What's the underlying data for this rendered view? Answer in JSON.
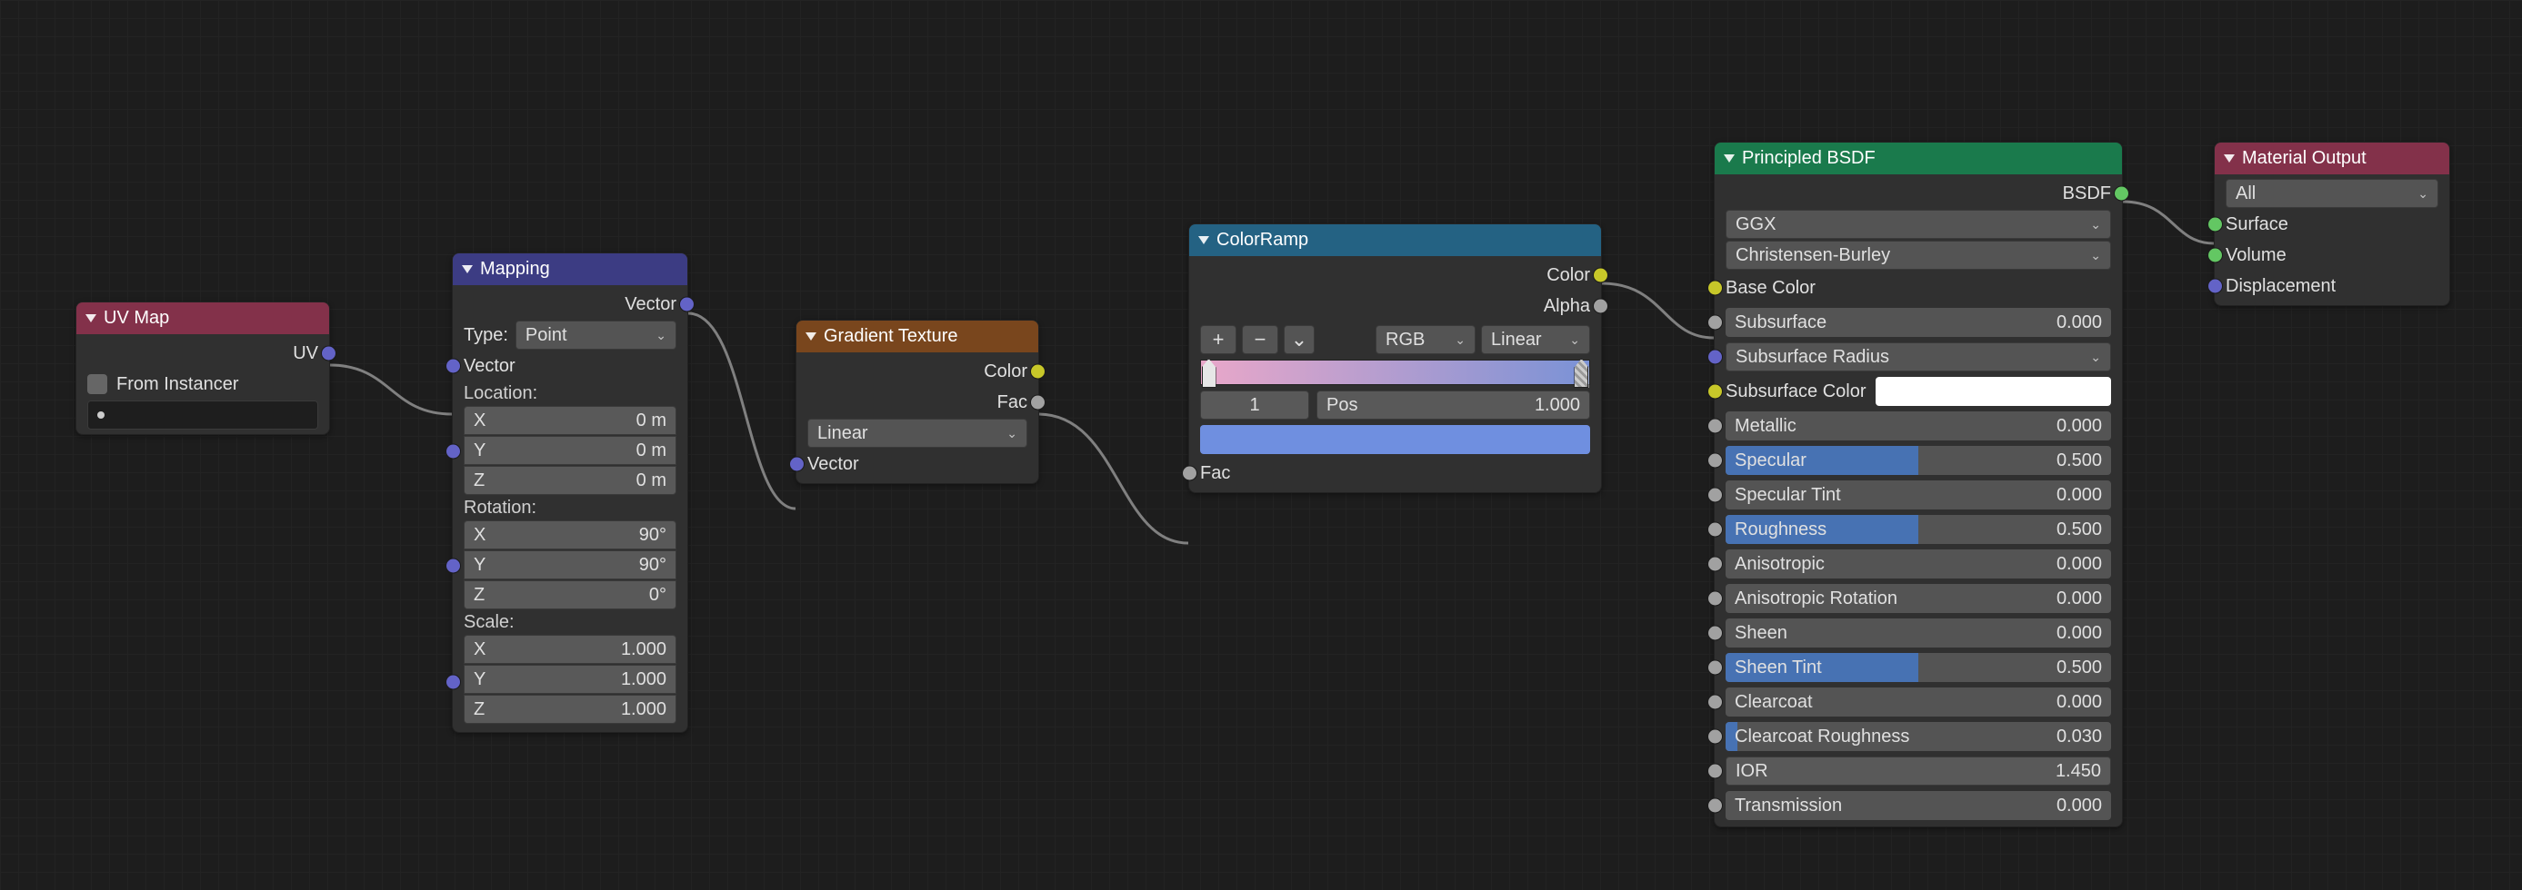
{
  "uvmap": {
    "title": "UV Map",
    "out_uv": "UV",
    "from_instancer": "From Instancer",
    "map_field_placeholder": ""
  },
  "mapping": {
    "title": "Mapping",
    "out_vector": "Vector",
    "type_label": "Type:",
    "type_value": "Point",
    "in_vector": "Vector",
    "location_label": "Location:",
    "location": {
      "x_k": "X",
      "x_v": "0 m",
      "y_k": "Y",
      "y_v": "0 m",
      "z_k": "Z",
      "z_v": "0 m"
    },
    "rotation_label": "Rotation:",
    "rotation": {
      "x_k": "X",
      "x_v": "90°",
      "y_k": "Y",
      "y_v": "90°",
      "z_k": "Z",
      "z_v": "0°"
    },
    "scale_label": "Scale:",
    "scale": {
      "x_k": "X",
      "x_v": "1.000",
      "y_k": "Y",
      "y_v": "1.000",
      "z_k": "Z",
      "z_v": "1.000"
    }
  },
  "gradient": {
    "title": "Gradient Texture",
    "out_color": "Color",
    "out_fac": "Fac",
    "type_value": "Linear",
    "in_vector": "Vector"
  },
  "ramp": {
    "title": "ColorRamp",
    "out_color": "Color",
    "out_alpha": "Alpha",
    "add": "+",
    "remove": "−",
    "mode": "RGB",
    "interp": "Linear",
    "index_label": "1",
    "pos_label": "Pos",
    "pos_value": "1.000",
    "in_fac": "Fac"
  },
  "bsdf": {
    "title": "Principled BSDF",
    "out_bsdf": "BSDF",
    "distribution": "GGX",
    "sss_method": "Christensen-Burley",
    "base_color": "Base Color",
    "subsurface": {
      "label": "Subsurface",
      "value": "0.000"
    },
    "subsurface_radius": "Subsurface Radius",
    "subsurface_color": "Subsurface Color",
    "metallic": {
      "label": "Metallic",
      "value": "0.000"
    },
    "specular": {
      "label": "Specular",
      "value": "0.500",
      "fill": 0.5
    },
    "specular_tint": {
      "label": "Specular Tint",
      "value": "0.000"
    },
    "roughness": {
      "label": "Roughness",
      "value": "0.500",
      "fill": 0.5
    },
    "anisotropic": {
      "label": "Anisotropic",
      "value": "0.000"
    },
    "anisotropic_rotation": {
      "label": "Anisotropic Rotation",
      "value": "0.000"
    },
    "sheen": {
      "label": "Sheen",
      "value": "0.000"
    },
    "sheen_tint": {
      "label": "Sheen Tint",
      "value": "0.500",
      "fill": 0.5
    },
    "clearcoat": {
      "label": "Clearcoat",
      "value": "0.000"
    },
    "clearcoat_roughness": {
      "label": "Clearcoat Roughness",
      "value": "0.030",
      "fill": 0.03
    },
    "ior": {
      "label": "IOR",
      "value": "1.450"
    },
    "transmission": {
      "label": "Transmission",
      "value": "0.000"
    }
  },
  "output": {
    "title": "Material Output",
    "target": "All",
    "surface": "Surface",
    "volume": "Volume",
    "displacement": "Displacement"
  }
}
